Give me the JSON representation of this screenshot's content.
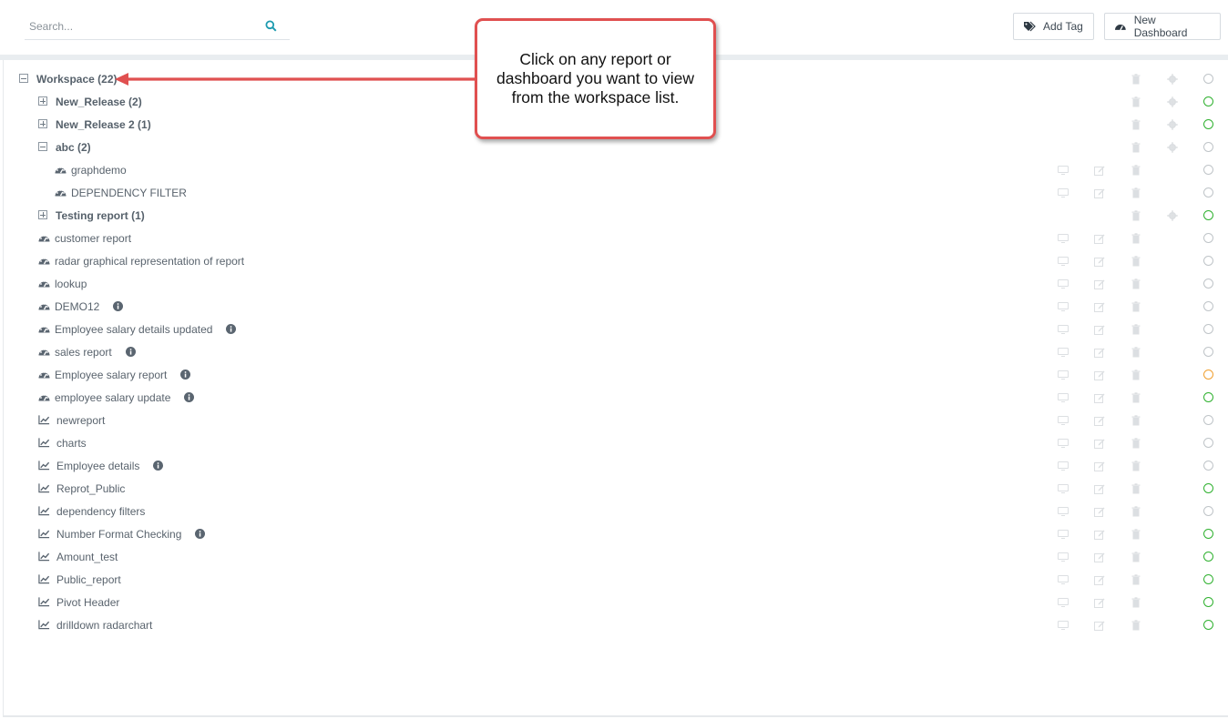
{
  "search": {
    "placeholder": "Search..."
  },
  "toolbar": {
    "add_tag_label": "Add Tag",
    "new_dashboard_label": "New Dashboard"
  },
  "callout": {
    "text": "Click on any report or dashboard you want to view from the workspace list."
  },
  "colors": {
    "status_active": "#2fb12f",
    "status_inactive": "#bfc4c8",
    "status_warning": "#f0a030",
    "callout_border": "#e05050"
  },
  "workspace": {
    "root": {
      "label": "Workspace (22)",
      "expanded": true,
      "status": "inactive"
    },
    "folders": [
      {
        "label": "New_Release (2)",
        "expanded": false,
        "status": "active"
      },
      {
        "label": "New_Release 2 (1)",
        "expanded": false,
        "status": "active"
      },
      {
        "label": "abc (2)",
        "expanded": true,
        "status": "inactive",
        "children": [
          {
            "label": "graphdemo",
            "type": "dashboard",
            "status": "inactive"
          },
          {
            "label": "DEPENDENCY FILTER",
            "type": "dashboard",
            "status": "inactive"
          }
        ]
      },
      {
        "label": "Testing report (1)",
        "expanded": false,
        "status": "active"
      }
    ],
    "items": [
      {
        "label": "customer report",
        "type": "dashboard",
        "info": false,
        "status": "inactive"
      },
      {
        "label": "radar graphical representation of report",
        "type": "dashboard",
        "info": false,
        "status": "inactive"
      },
      {
        "label": "lookup",
        "type": "dashboard",
        "info": false,
        "status": "inactive"
      },
      {
        "label": "DEMO12",
        "type": "dashboard",
        "info": true,
        "status": "inactive"
      },
      {
        "label": "Employee salary details updated",
        "type": "dashboard",
        "info": true,
        "status": "inactive"
      },
      {
        "label": "sales report",
        "type": "dashboard",
        "info": true,
        "status": "inactive"
      },
      {
        "label": "Employee salary report",
        "type": "dashboard",
        "info": true,
        "status": "warning"
      },
      {
        "label": "employee salary update",
        "type": "dashboard",
        "info": true,
        "status": "active"
      },
      {
        "label": "newreport",
        "type": "report",
        "info": false,
        "status": "inactive"
      },
      {
        "label": "charts",
        "type": "report",
        "info": false,
        "status": "inactive"
      },
      {
        "label": "Employee details",
        "type": "report",
        "info": true,
        "status": "inactive"
      },
      {
        "label": "Reprot_Public",
        "type": "report",
        "info": false,
        "status": "active"
      },
      {
        "label": "dependency filters",
        "type": "report",
        "info": false,
        "status": "inactive"
      },
      {
        "label": "Number Format Checking",
        "type": "report",
        "info": true,
        "status": "active"
      },
      {
        "label": "Amount_test",
        "type": "report",
        "info": false,
        "status": "active"
      },
      {
        "label": "Public_report",
        "type": "report",
        "info": false,
        "status": "active"
      },
      {
        "label": "Pivot Header",
        "type": "report",
        "info": false,
        "status": "active"
      },
      {
        "label": "drilldown radarchart",
        "type": "report",
        "info": false,
        "status": "active"
      }
    ]
  }
}
